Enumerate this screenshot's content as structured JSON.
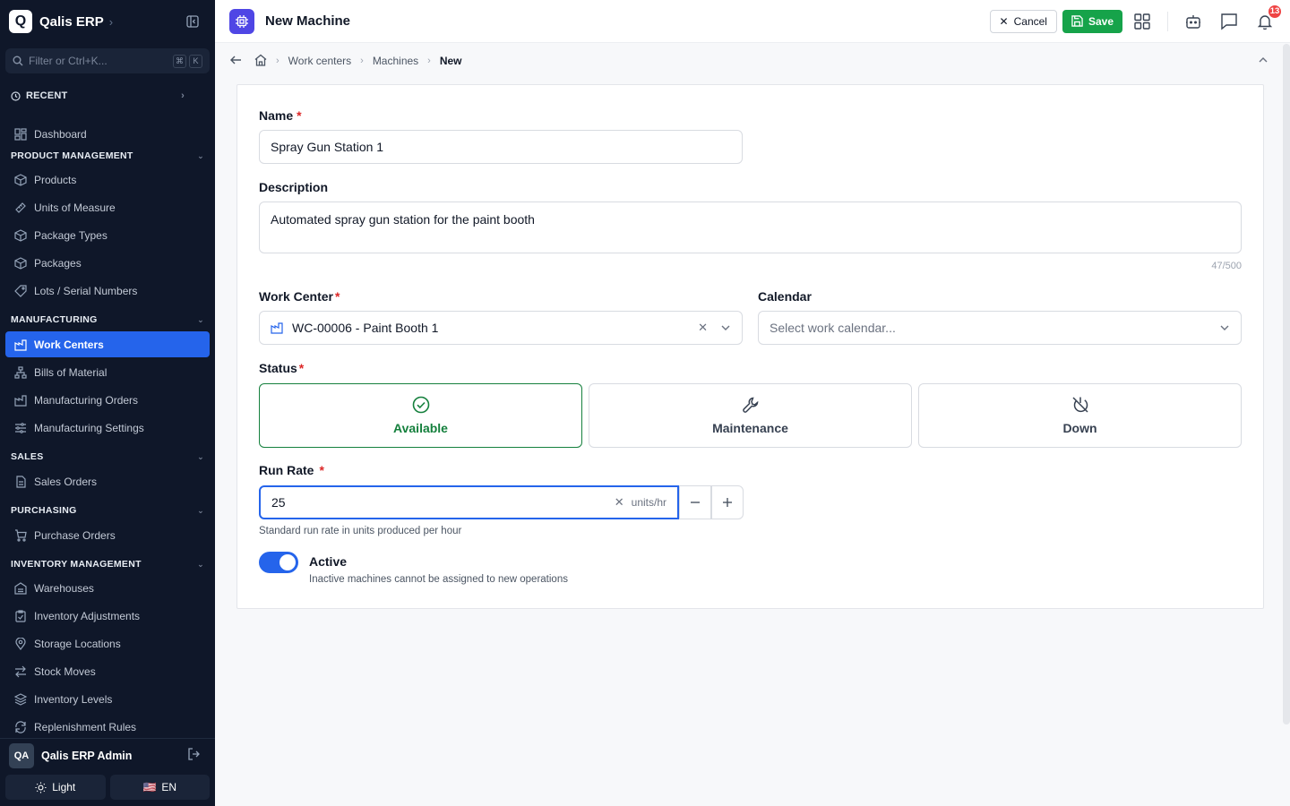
{
  "sidebar": {
    "app_name": "Qalis ERP",
    "logo_letter": "Q",
    "filter_placeholder": "Filter or Ctrl+K...",
    "kbd": [
      "⌘",
      "K"
    ],
    "recent_label": "RECENT",
    "dashboard": "Dashboard",
    "sections": {
      "product": "PRODUCT MANAGEMENT",
      "manufacturing": "MANUFACTURING",
      "sales": "SALES",
      "purchasing": "PURCHASING",
      "inventory": "INVENTORY MANAGEMENT"
    },
    "product_items": [
      "Products",
      "Units of Measure",
      "Package Types",
      "Packages",
      "Lots / Serial Numbers"
    ],
    "manufacturing_items": [
      "Work Centers",
      "Bills of Material",
      "Manufacturing Orders",
      "Manufacturing Settings"
    ],
    "sales_items": [
      "Sales Orders"
    ],
    "purchasing_items": [
      "Purchase Orders"
    ],
    "inventory_items": [
      "Warehouses",
      "Inventory Adjustments",
      "Storage Locations",
      "Stock Moves",
      "Inventory Levels",
      "Replenishment Rules"
    ],
    "user": {
      "initials": "QA",
      "name": "Qalis ERP Admin"
    },
    "theme_label": "Light",
    "lang_flag": "🇺🇸",
    "lang_label": "EN"
  },
  "topbar": {
    "title": "New Machine",
    "cancel_label": "Cancel",
    "save_label": "Save",
    "notifications_count": "13"
  },
  "breadcrumb": [
    "Work centers",
    "Machines",
    "New"
  ],
  "form": {
    "name_label": "Name",
    "name_value": "Spray Gun Station 1",
    "description_label": "Description",
    "description_value": "Automated spray gun station for the paint booth",
    "description_counter": "47/500",
    "work_center_label": "Work Center",
    "work_center_value": "WC-00006 - Paint Booth 1",
    "calendar_label": "Calendar",
    "calendar_placeholder": "Select work calendar...",
    "status_label": "Status",
    "status_options": [
      "Available",
      "Maintenance",
      "Down"
    ],
    "status_selected": "Available",
    "run_rate_label": "Run Rate",
    "run_rate_value": "25",
    "run_rate_unit": "units/hr",
    "run_rate_hint": "Standard run rate in units produced per hour",
    "active_label": "Active",
    "active_hint": "Inactive machines cannot be assigned to new operations",
    "active_on": true
  },
  "colors": {
    "sidebar_bg": "#0f1729",
    "accent": "#2564eb",
    "save": "#16a34a",
    "selected_status": "#15803d",
    "required": "#dc2626",
    "badge": "#ef4444"
  }
}
